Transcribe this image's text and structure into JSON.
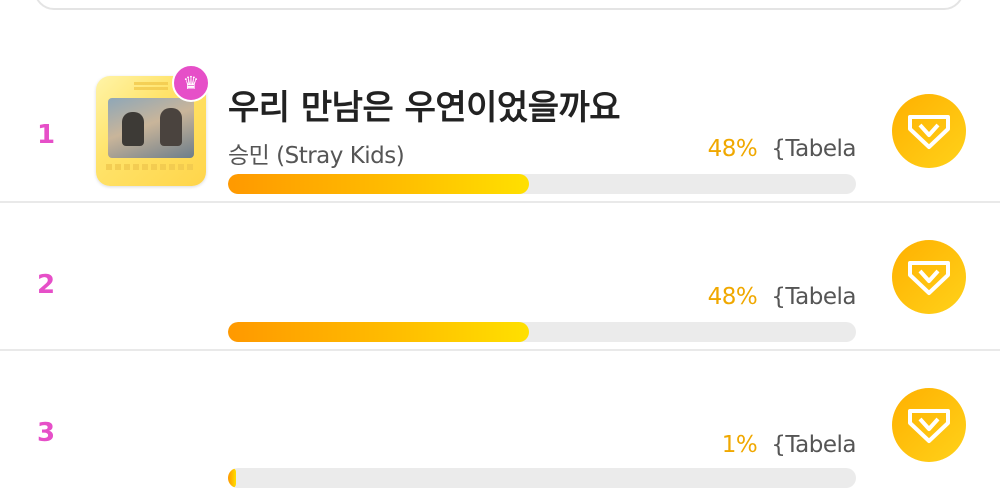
{
  "colors": {
    "rank": "#e64fc8",
    "percent": "#f0a800",
    "bar_start": "#ff9900",
    "bar_end": "#ffe000",
    "track": "#ebebeb",
    "vote_button": "#ffb000"
  },
  "rows": [
    {
      "rank": "1",
      "title": "우리 만남은 우연이었을까요",
      "artist": "승민 (Stray Kids)",
      "percent_label": "48%",
      "tabela": "{Tabela",
      "progress": 0.48,
      "icon": "album-cover",
      "badge_icon": "crown-icon",
      "vote_icon": "vote-heart-icon"
    },
    {
      "rank": "2",
      "title": "",
      "artist": "",
      "percent_label": "48%",
      "tabela": "{Tabela",
      "progress": 0.48,
      "vote_icon": "vote-heart-icon"
    },
    {
      "rank": "3",
      "title": "",
      "artist": "",
      "percent_label": "1%",
      "tabela": "{Tabela",
      "progress": 0.01,
      "vote_icon": "vote-heart-icon"
    }
  ]
}
